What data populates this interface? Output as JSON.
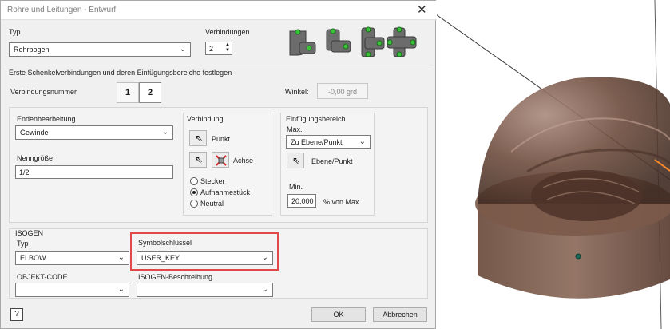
{
  "window": {
    "title": "Rohre und Leitungen - Entwurf"
  },
  "typ": {
    "label": "Typ",
    "value": "Rohrbogen"
  },
  "verbindungen": {
    "label": "Verbindungen",
    "value": "2"
  },
  "section_header": "Erste Schenkelverbindungen und deren Einfügungsbereiche festlegen",
  "verbindungsnummer": {
    "label": "Verbindungsnummer",
    "buttons": [
      "1",
      "2"
    ],
    "selected": "2"
  },
  "winkel": {
    "label": "Winkel:",
    "value": "-0,00 grd"
  },
  "endenbearbeitung": {
    "label": "Endenbearbeitung",
    "value": "Gewinde"
  },
  "nenngroesse": {
    "label": "Nenngröße",
    "value": "1/2"
  },
  "verbindung": {
    "title": "Verbindung",
    "punkt_label": "Punkt",
    "achse_label": "Achse",
    "radios": [
      {
        "label": "Stecker",
        "selected": false
      },
      {
        "label": "Aufnahmestück",
        "selected": true
      },
      {
        "label": "Neutral",
        "selected": false
      }
    ]
  },
  "einfuegung": {
    "title": "Einfügungsbereich",
    "max_label": "Max.",
    "max_value": "Zu Ebene/Punkt",
    "ebene_label": "Ebene/Punkt",
    "min_label": "Min.",
    "min_value": "20,000",
    "min_unit": "% von Max."
  },
  "isogen": {
    "title": "ISOGEN",
    "typ_label": "Typ",
    "typ_value": "ELBOW",
    "symbol_label": "Symbolschlüssel",
    "symbol_value": "USER_KEY",
    "objekt_label": "OBJEKT-CODE",
    "objekt_value": "",
    "beschreibung_label": "ISOGEN-Beschreibung",
    "beschreibung_value": ""
  },
  "footer": {
    "help_label": "?",
    "ok_label": "OK",
    "cancel_label": "Abbrechen"
  },
  "icons": [
    "cursor-arrow-icon",
    "axis-select-icon",
    "help-icon",
    "close-icon",
    "fitting-preview-icon"
  ],
  "colors": {
    "highlight": "#e0484a",
    "model_brown": "#6b4a3a",
    "dialog_bg": "#f0f0f0"
  }
}
